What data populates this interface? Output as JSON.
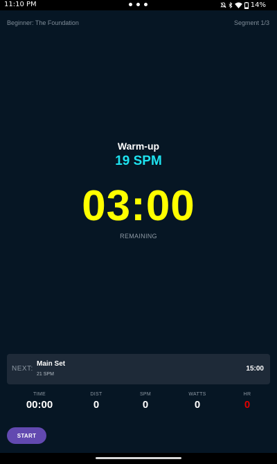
{
  "status_bar": {
    "time": "11:10 PM",
    "battery": "14%",
    "icons": [
      "mute-icon",
      "bluetooth-icon",
      "wifi-icon",
      "battery-icon"
    ]
  },
  "header": {
    "workout_title": "Beginner: The Foundation",
    "segment_indicator": "Segment 1/3"
  },
  "current": {
    "segment_name": "Warm-up",
    "spm": "19 SPM",
    "timer": "03:00",
    "timer_caption": "REMAINING"
  },
  "next": {
    "label": "NEXT:",
    "name": "Main Set",
    "spm": "21 SPM",
    "duration": "15:00"
  },
  "stats": [
    {
      "label": "TIME",
      "value": "00:00"
    },
    {
      "label": "DIST",
      "value": "0"
    },
    {
      "label": "SPM",
      "value": "0"
    },
    {
      "label": "WATTS",
      "value": "0"
    },
    {
      "label": "HR",
      "value": "0"
    }
  ],
  "controls": {
    "start_label": "START"
  },
  "colors": {
    "background": "#061624",
    "spm_accent": "#1ee3f0",
    "timer": "#ffff00",
    "hr_value": "#e00000",
    "start_button": "#6249b0",
    "card": "#1e2a38"
  }
}
